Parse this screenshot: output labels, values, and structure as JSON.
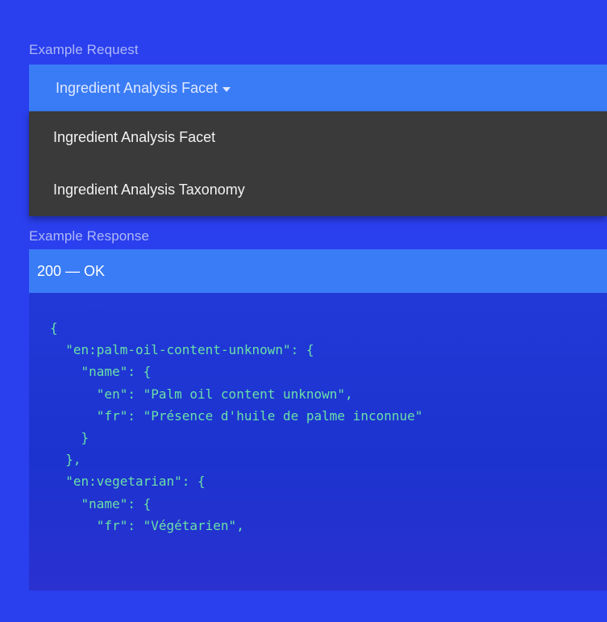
{
  "request": {
    "label": "Example Request",
    "selected": "Ingredient Analysis Facet",
    "options": [
      "Ingredient Analysis Facet",
      "Ingredient Analysis Taxonomy"
    ]
  },
  "response": {
    "label": "Example Response",
    "status": "200 — OK",
    "code_lines": [
      "{",
      "  \"en:palm-oil-content-unknown\": {",
      "    \"name\": {",
      "      \"en\": \"Palm oil content unknown\",",
      "      \"fr\": \"Présence d'huile de palme inconnue\"",
      "    }",
      "  },",
      "  \"en:vegetarian\": {",
      "    \"name\": {",
      "      \"fr\": \"Végétarien\","
    ]
  },
  "colors": {
    "page_background": "#2a3fee",
    "select_background": "#3a7cf6",
    "menu_background": "#3a3a3a",
    "code_text": "#6ae0a8"
  },
  "icons": {
    "select_caret": "caret-down-icon"
  }
}
